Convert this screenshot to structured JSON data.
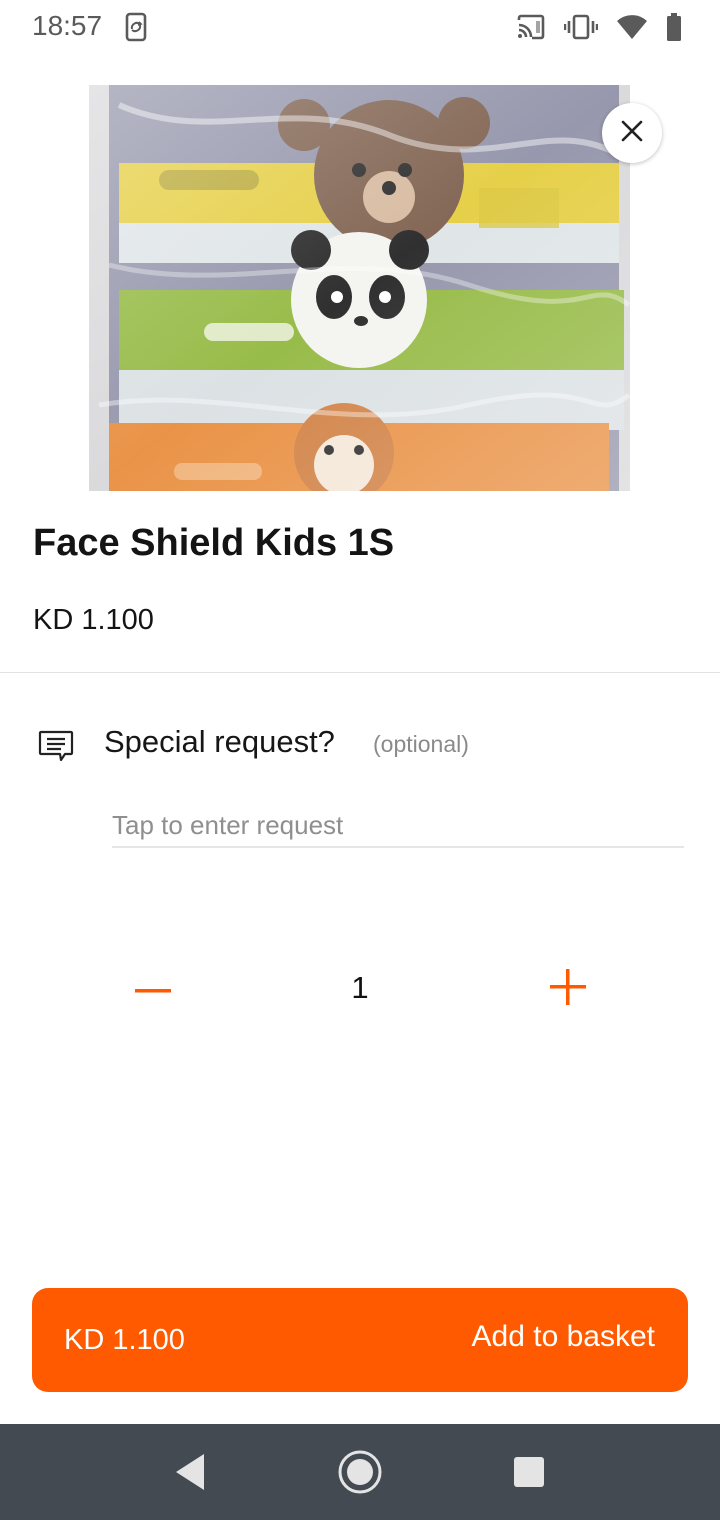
{
  "status_bar": {
    "time": "18:57",
    "icons": [
      "sync-phone-icon",
      "cast-icon",
      "vibrate-icon",
      "wifi-icon",
      "battery-icon"
    ]
  },
  "product": {
    "image": "face-shield-kids-product-photo",
    "title": "Face Shield Kids 1S",
    "price": "KD 1.100"
  },
  "special_request": {
    "label": "Special request?",
    "optional": "(optional)",
    "placeholder": "Tap to enter request",
    "value": ""
  },
  "quantity": {
    "value": "1"
  },
  "basket_button": {
    "price": "KD 1.100",
    "label": "Add to basket"
  },
  "colors": {
    "accent": "#ff5a00",
    "nav_bar": "#444a52"
  },
  "nav_bar": {
    "icons": [
      "back-icon",
      "home-icon",
      "recents-icon"
    ]
  }
}
